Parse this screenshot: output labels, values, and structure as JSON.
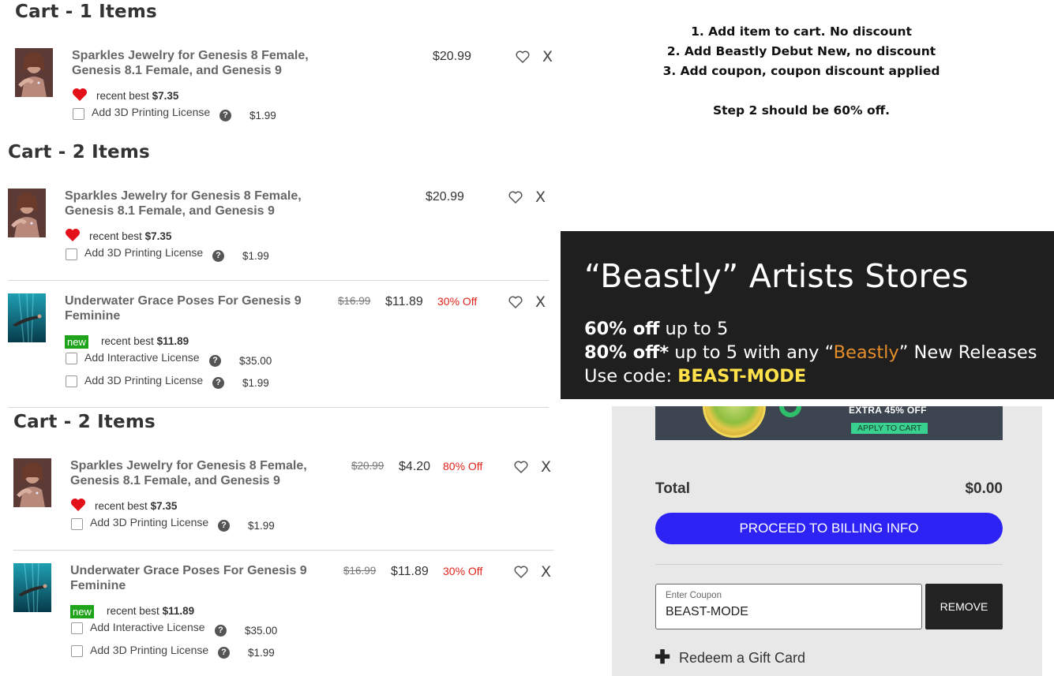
{
  "carts": [
    {
      "title": "Cart - 1 Items",
      "items": [
        {
          "name": "Sparkles Jewelry for Genesis 8 Female, Genesis 8.1 Female, and Genesis 9",
          "old_price": "",
          "price": "$20.99",
          "discount": "",
          "badge": "heart",
          "badge_text": "",
          "recent_label": "recent best",
          "recent_price": "$7.35",
          "thumb_icon": "woman-portrait-thumbnail",
          "options": [
            {
              "label": "Add 3D Printing License",
              "price": "$1.99"
            }
          ]
        }
      ]
    },
    {
      "title": "Cart - 2 Items",
      "items": [
        {
          "name": "Sparkles Jewelry for Genesis 8 Female, Genesis 8.1 Female, and Genesis 9",
          "old_price": "",
          "price": "$20.99",
          "discount": "",
          "badge": "heart",
          "badge_text": "",
          "recent_label": "recent best",
          "recent_price": "$7.35",
          "thumb_icon": "woman-portrait-thumbnail",
          "options": [
            {
              "label": "Add 3D Printing License",
              "price": "$1.99"
            }
          ]
        },
        {
          "name": "Underwater Grace Poses For Genesis 9 Feminine",
          "old_price": "$16.99",
          "price": "$11.89",
          "discount": "30% Off",
          "badge": "new",
          "badge_text": "new",
          "recent_label": "recent best",
          "recent_price": "$11.89",
          "thumb_icon": "underwater-swimmer-thumbnail",
          "options": [
            {
              "label": "Add Interactive License",
              "price": "$35.00"
            },
            {
              "label": "Add 3D Printing License",
              "price": "$1.99"
            }
          ]
        }
      ]
    },
    {
      "title": "Cart - 2 Items",
      "items": [
        {
          "name": "Sparkles Jewelry for Genesis 8 Female, Genesis 8.1 Female, and Genesis 9",
          "old_price": "$20.99",
          "price": "$4.20",
          "discount": "80% Off",
          "badge": "heart",
          "badge_text": "",
          "recent_label": "recent best",
          "recent_price": "$7.35",
          "thumb_icon": "woman-portrait-thumbnail",
          "options": [
            {
              "label": "Add 3D Printing License",
              "price": "$1.99"
            }
          ]
        },
        {
          "name": "Underwater Grace Poses For Genesis 9 Feminine",
          "old_price": "$16.99",
          "price": "$11.89",
          "discount": "30% Off",
          "badge": "new",
          "badge_text": "new",
          "recent_label": "recent best",
          "recent_price": "$11.89",
          "thumb_icon": "underwater-swimmer-thumbnail",
          "options": [
            {
              "label": "Add Interactive License",
              "price": "$35.00"
            },
            {
              "label": "Add 3D Printing License",
              "price": "$1.99"
            }
          ]
        }
      ]
    }
  ],
  "item_actions": {
    "wishlist_icon": "heart-outline-icon",
    "remove_label": "X"
  },
  "help_glyph": "?",
  "notes": {
    "lines": [
      "1. Add item to cart. No discount",
      "2. Add Beastly Debut New, no discount",
      "3. Add coupon, coupon discount applied"
    ],
    "conclusion": "Step 2 should be 60% off."
  },
  "promo_overlay": {
    "title": "“Beastly” Artists Stores",
    "line1_bold": "60% off",
    "line1_rest": " up to 5",
    "line2_bold": "80% off*",
    "line2_a": " up to 5 with any “",
    "line2_brand": "Beastly",
    "line2_b": "” New Releases",
    "line3_prefix": "Use code: ",
    "line3_code": "BEAST-MODE",
    "brand_color": "#e48d2a",
    "code_color": "#ffe14a"
  },
  "checkout": {
    "banner_text": "EXTRA 45% OFF",
    "banner_apply": "APPLY TO CART",
    "total_label": "Total",
    "total_value": "$0.00",
    "proceed_label": "PROCEED TO BILLING INFO",
    "coupon_placeholder": "Enter Coupon",
    "coupon_value": "BEAST-MODE",
    "remove_label": "REMOVE",
    "gift_icon": "plus-icon",
    "gift_label": "Redeem a Gift Card",
    "accent_color": "#2d23f5"
  }
}
